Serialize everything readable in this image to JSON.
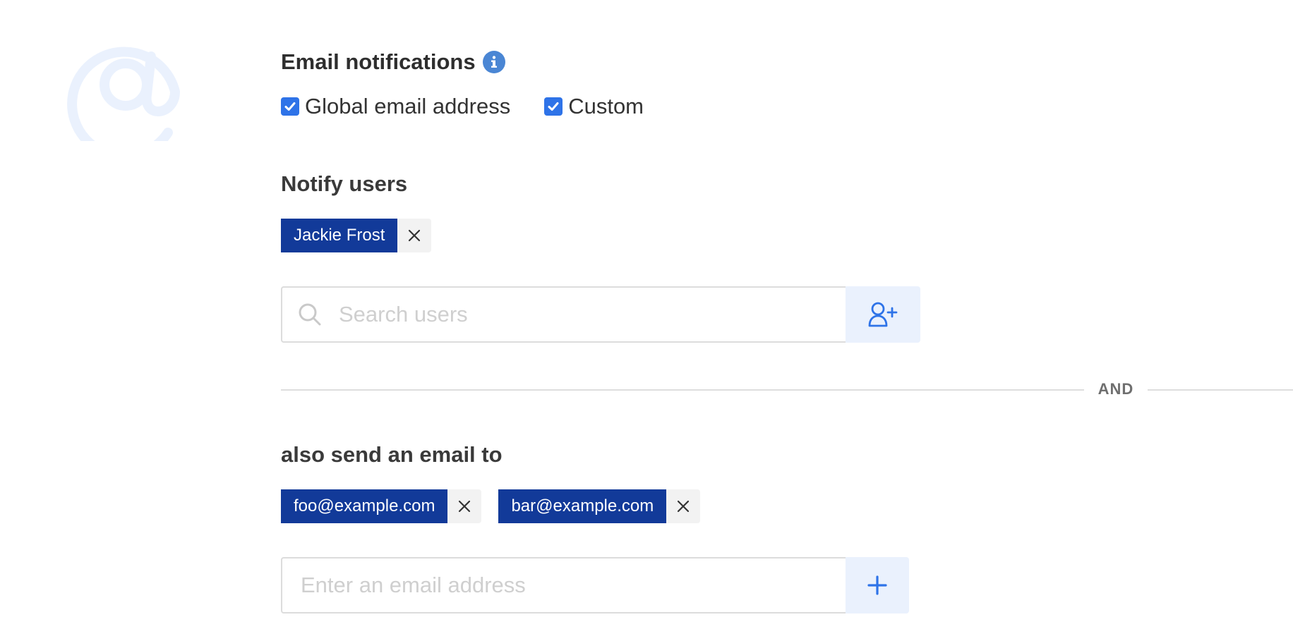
{
  "email_notifications": {
    "title": "Email notifications",
    "options": [
      {
        "label": "Global email address",
        "checked": true
      },
      {
        "label": "Custom",
        "checked": true
      }
    ]
  },
  "notify_users": {
    "title": "Notify users",
    "users": [
      "Jackie Frost"
    ],
    "search_placeholder": "Search users"
  },
  "divider": {
    "label": "AND"
  },
  "also_send": {
    "title": "also send an email to",
    "emails": [
      "foo@example.com",
      "bar@example.com"
    ],
    "email_placeholder": "Enter an email address"
  },
  "colors": {
    "accent": "#2e73e8",
    "chip": "#123a99",
    "button_bg": "#eaf1fd",
    "logo": "#eaf1fd"
  },
  "icons": [
    "at-logo-icon",
    "info-icon",
    "checkmark-icon",
    "close-icon",
    "search-icon",
    "add-user-icon",
    "plus-icon"
  ]
}
